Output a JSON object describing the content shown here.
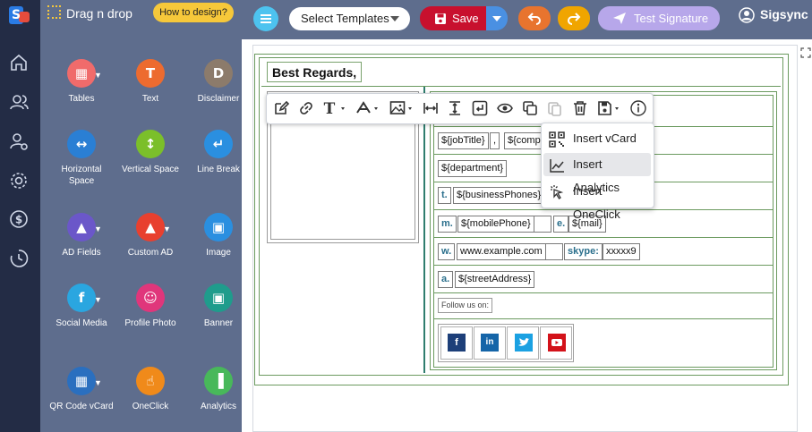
{
  "app": {
    "name": "Sigsync"
  },
  "palette": {
    "title": "Drag n drop",
    "how_button": "How to design?",
    "tools": [
      {
        "label": "Tables",
        "icon": "table-icon",
        "color": "#f06b6b",
        "caret": true
      },
      {
        "label": "Text",
        "icon": "text-icon",
        "color": "#ed6b2f",
        "caret": false
      },
      {
        "label": "Disclaimer",
        "icon": "disclaimer-icon",
        "color": "#8c7b6b",
        "caret": false
      },
      {
        "label": "Horizontal Space",
        "icon": "horizontal-space-icon",
        "color": "#2a7fd4",
        "caret": false
      },
      {
        "label": "Vertical Space",
        "icon": "vertical-space-icon",
        "color": "#7bbf2a",
        "caret": false
      },
      {
        "label": "Line Break",
        "icon": "line-break-icon",
        "color": "#2a8fe0",
        "caret": false
      },
      {
        "label": "AD Fields",
        "icon": "ad-fields-icon",
        "color": "#6b57c9",
        "caret": true
      },
      {
        "label": "Custom AD",
        "icon": "custom-ad-icon",
        "color": "#e8402f",
        "caret": true
      },
      {
        "label": "Image",
        "icon": "image-icon",
        "color": "#2a8fe0",
        "caret": false
      },
      {
        "label": "Social Media",
        "icon": "social-media-icon",
        "color": "#2aa6e0",
        "caret": true
      },
      {
        "label": "Profile Photo",
        "icon": "profile-photo-icon",
        "color": "#e0367b",
        "caret": false
      },
      {
        "label": "Banner",
        "icon": "banner-icon",
        "color": "#1f9c8c",
        "caret": false
      },
      {
        "label": "QR Code vCard",
        "icon": "qr-code-icon",
        "color": "#2a6fbf",
        "caret": true
      },
      {
        "label": "OneClick",
        "icon": "oneclick-icon",
        "color": "#f08a1a",
        "caret": false
      },
      {
        "label": "Analytics",
        "icon": "analytics-icon",
        "color": "#48b85a",
        "caret": false
      }
    ]
  },
  "topbar": {
    "templates_label": "Select Templates",
    "save_label": "Save",
    "test_label": "Test Signature",
    "user_name": "Sigsync"
  },
  "signature": {
    "greeting": "Best Regards,",
    "job_title": "${jobTitle}",
    "comma": ",",
    "company": "${compa",
    "department": "${department}",
    "phone_label": "t.",
    "business_phones": "${businessPhones}",
    "mobile_label": "m.",
    "mobile_phone": "${mobilePhone}",
    "email_label": "e.",
    "mail": "${mail}",
    "web_label": "w.",
    "website": "www.example.com",
    "skype_label": "skype:",
    "skype": "xxxxx9",
    "address_label": "a.",
    "street_address": "${streetAddress}",
    "follow_text": "Follow us on:",
    "social": [
      "facebook",
      "linkedin",
      "twitter",
      "youtube"
    ]
  },
  "insert_menu": {
    "items": [
      {
        "label": "Insert vCard",
        "icon": "qr-code-icon"
      },
      {
        "label": "Insert Analytics",
        "icon": "analytics-chart-icon",
        "highlighted": true
      },
      {
        "label": "Insert OneClick",
        "icon": "cursor-click-icon"
      }
    ]
  },
  "colors": {
    "accent": "#4dc3ef",
    "save": "#c8102e",
    "palette_bg": "#5e6d8d",
    "rail_bg": "#232c45"
  }
}
